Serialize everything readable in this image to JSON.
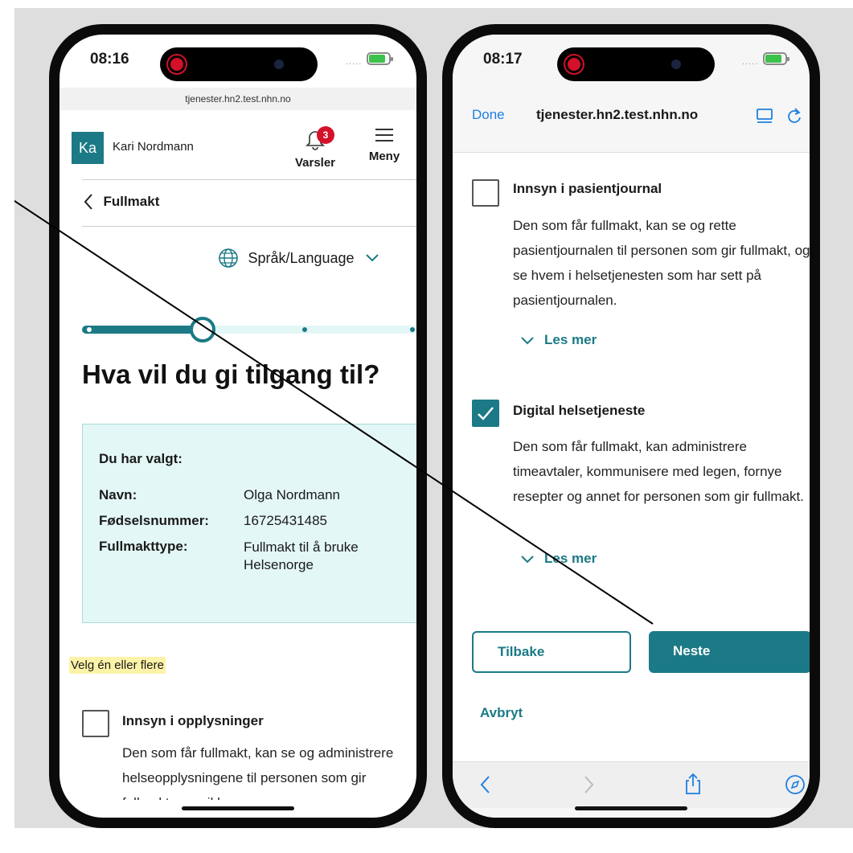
{
  "left_phone": {
    "status": {
      "time": "08:16"
    },
    "url": "tjenester.hn2.test.nhn.no",
    "header": {
      "avatar_initials": "Ka",
      "user_name": "Kari Nordmann",
      "notification_count": "3",
      "notifications_label": "Varsler",
      "menu_label": "Meny"
    },
    "back_label": "Fullmakt",
    "language_label": "Språk/Language",
    "progress": {
      "steps": 4,
      "current_step": 2
    },
    "heading": "Hva vil du gi tilgang til?",
    "summary": {
      "title": "Du har valgt:",
      "rows": [
        {
          "label": "Navn:",
          "value": "Olga Nordmann"
        },
        {
          "label": "Fødselsnummer:",
          "value": "16725431485"
        },
        {
          "label": "Fullmakttype:",
          "value": "Fullmakt til å bruke Helsenorge"
        }
      ]
    },
    "hint": "Velg én eller flere",
    "option": {
      "title": "Innsyn i opplysninger",
      "description": "Den som får fullmakt, kan se og administrere helseopplysningene til personen som gir fullmakt, men ikke se"
    }
  },
  "right_phone": {
    "status": {
      "time": "08:17"
    },
    "safari": {
      "done_label": "Done",
      "url": "tjenester.hn2.test.nhn.no"
    },
    "options": [
      {
        "title": "Innsyn i pasientjournal",
        "checked": false,
        "description": "Den som får fullmakt, kan se og rette pasientjournalen til personen som gir fullmakt, og se hvem i helsetjenesten som har sett på pasientjournalen.",
        "read_more": "Les mer"
      },
      {
        "title": "Digital helsetjeneste",
        "checked": true,
        "description": "Den som får fullmakt, kan administrere timeavtaler, kommunisere med legen, fornye resepter og annet for personen som gir fullmakt.",
        "read_more": "Les mer"
      }
    ],
    "back_button": "Tilbake",
    "next_button": "Neste",
    "cancel_link": "Avbryt"
  },
  "colors": {
    "accent": "#1b7a85",
    "summary_bg": "#e3f7f6",
    "hint_bg": "#fdf3a8",
    "recording": "#d31128"
  }
}
